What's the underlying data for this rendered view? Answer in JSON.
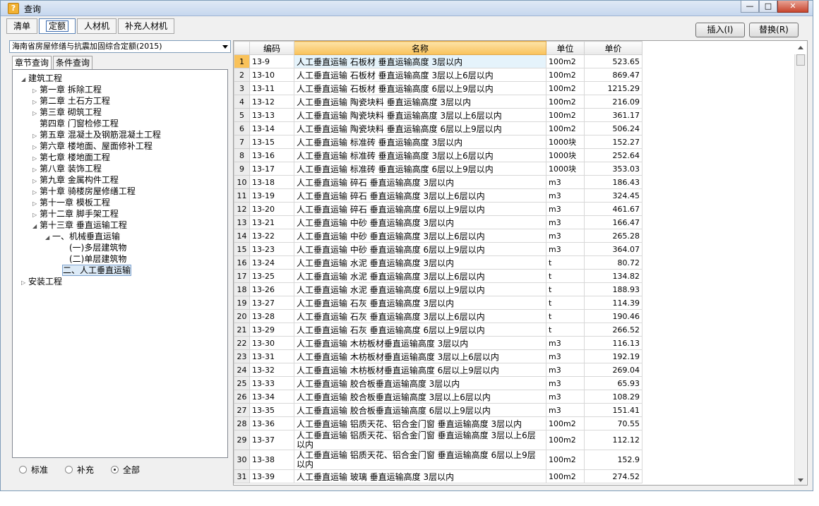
{
  "window": {
    "title": "查询",
    "minimize": "—",
    "maximize": "□",
    "close": "✕"
  },
  "toolbar": {
    "tabs": [
      "清单",
      "定额",
      "人材机",
      "补充人材机"
    ],
    "active": "定额"
  },
  "actions": {
    "insert": "插入(I)",
    "replace": "替换(R)"
  },
  "quota_selector": "海南省房屋修缮与抗震加固综合定额(2015)",
  "search_tabs": [
    "章节查询",
    "条件查询"
  ],
  "tree": [
    {
      "label": "建筑工程",
      "toggle": "◢"
    },
    {
      "label": "第一章  拆除工程",
      "toggle": "▷"
    },
    {
      "label": "第二章  土石方工程",
      "toggle": "▷"
    },
    {
      "label": "第三章  砌筑工程",
      "toggle": "▷"
    },
    {
      "label": "第四章  门窗检修工程",
      "toggle": ""
    },
    {
      "label": "第五章  混凝土及钢筋混凝土工程",
      "toggle": "▷"
    },
    {
      "label": "第六章  楼地面、屋面修补工程",
      "toggle": "▷"
    },
    {
      "label": "第七章  楼地面工程",
      "toggle": "▷"
    },
    {
      "label": "第八章  装饰工程",
      "toggle": "▷"
    },
    {
      "label": "第九章  金属构件工程",
      "toggle": "▷"
    },
    {
      "label": "第十章  骑楼房屋修缮工程",
      "toggle": "▷"
    },
    {
      "label": "第十一章  模板工程",
      "toggle": "▷"
    },
    {
      "label": "第十二章  脚手架工程",
      "toggle": "▷"
    },
    {
      "label": "第十三章  垂直运输工程",
      "toggle": "◢"
    },
    {
      "label": "一、机械垂直运输",
      "toggle": "◢"
    },
    {
      "label": "(一)多层建筑物",
      "toggle": ""
    },
    {
      "label": "(二)单层建筑物",
      "toggle": ""
    },
    {
      "label": "二、人工垂直运输",
      "toggle": ""
    },
    {
      "label": "安装工程",
      "toggle": "▷"
    }
  ],
  "filters": [
    {
      "label": "标准",
      "selected": false
    },
    {
      "label": "补充",
      "selected": false
    },
    {
      "label": "全部",
      "selected": true
    }
  ],
  "table": {
    "columns": [
      "编码",
      "名称",
      "单位",
      "单价"
    ],
    "rows": [
      [
        "13-9",
        "人工垂直运输 石板材 垂直运输高度 3层以内",
        "100m2",
        "523.65"
      ],
      [
        "13-10",
        "人工垂直运输 石板材 垂直运输高度 3层以上6层以内",
        "100m2",
        "869.47"
      ],
      [
        "13-11",
        "人工垂直运输 石板材 垂直运输高度 6层以上9层以内",
        "100m2",
        "1215.29"
      ],
      [
        "13-12",
        "人工垂直运输 陶瓷块料 垂直运输高度 3层以内",
        "100m2",
        "216.09"
      ],
      [
        "13-13",
        "人工垂直运输 陶瓷块料 垂直运输高度 3层以上6层以内",
        "100m2",
        "361.17"
      ],
      [
        "13-14",
        "人工垂直运输 陶瓷块料 垂直运输高度 6层以上9层以内",
        "100m2",
        "506.24"
      ],
      [
        "13-15",
        "人工垂直运输 标准砖 垂直运输高度 3层以内",
        "1000块",
        "152.27"
      ],
      [
        "13-16",
        "人工垂直运输 标准砖 垂直运输高度 3层以上6层以内",
        "1000块",
        "252.64"
      ],
      [
        "13-17",
        "人工垂直运输 标准砖 垂直运输高度 6层以上9层以内",
        "1000块",
        "353.03"
      ],
      [
        "13-18",
        "人工垂直运输 碎石 垂直运输高度 3层以内",
        "m3",
        "186.43"
      ],
      [
        "13-19",
        "人工垂直运输 碎石 垂直运输高度 3层以上6层以内",
        "m3",
        "324.45"
      ],
      [
        "13-20",
        "人工垂直运输 碎石 垂直运输高度 6层以上9层以内",
        "m3",
        "461.67"
      ],
      [
        "13-21",
        "人工垂直运输 中砂 垂直运输高度 3层以内",
        "m3",
        "166.47"
      ],
      [
        "13-22",
        "人工垂直运输 中砂 垂直运输高度 3层以上6层以内",
        "m3",
        "265.28"
      ],
      [
        "13-23",
        "人工垂直运输 中砂 垂直运输高度 6层以上9层以内",
        "m3",
        "364.07"
      ],
      [
        "13-24",
        "人工垂直运输 水泥 垂直运输高度 3层以内",
        "t",
        "80.72"
      ],
      [
        "13-25",
        "人工垂直运输 水泥 垂直运输高度 3层以上6层以内",
        "t",
        "134.82"
      ],
      [
        "13-26",
        "人工垂直运输 水泥 垂直运输高度 6层以上9层以内",
        "t",
        "188.93"
      ],
      [
        "13-27",
        "人工垂直运输 石灰 垂直运输高度 3层以内",
        "t",
        "114.39"
      ],
      [
        "13-28",
        "人工垂直运输 石灰 垂直运输高度 3层以上6层以内",
        "t",
        "190.46"
      ],
      [
        "13-29",
        "人工垂直运输 石灰 垂直运输高度 6层以上9层以内",
        "t",
        "266.52"
      ],
      [
        "13-30",
        "人工垂直运输 木枋板材垂直运输高度 3层以内",
        "m3",
        "116.13"
      ],
      [
        "13-31",
        "人工垂直运输 木枋板材垂直运输高度 3层以上6层以内",
        "m3",
        "192.19"
      ],
      [
        "13-32",
        "人工垂直运输 木枋板材垂直运输高度 6层以上9层以内",
        "m3",
        "269.04"
      ],
      [
        "13-33",
        "人工垂直运输 胶合板垂直运输高度 3层以内",
        "m3",
        "65.93"
      ],
      [
        "13-34",
        "人工垂直运输 胶合板垂直运输高度 3层以上6层以内",
        "m3",
        "108.29"
      ],
      [
        "13-35",
        "人工垂直运输 胶合板垂直运输高度 6层以上9层以内",
        "m3",
        "151.41"
      ],
      [
        "13-36",
        "人工垂直运输 铝质天花、铝合金门窗 垂直运输高度 3层以内",
        "100m2",
        "70.55"
      ],
      [
        "13-37",
        "人工垂直运输 铝质天花、铝合金门窗 垂直运输高度 3层以上6层以内",
        "100m2",
        "112.12"
      ],
      [
        "13-38",
        "人工垂直运输 铝质天花、铝合金门窗 垂直运输高度 6层以上9层以内",
        "100m2",
        "152.9"
      ],
      [
        "13-39",
        "人工垂直运输 玻璃 垂直运输高度 3层以内",
        "100m2",
        "274.52"
      ]
    ]
  }
}
